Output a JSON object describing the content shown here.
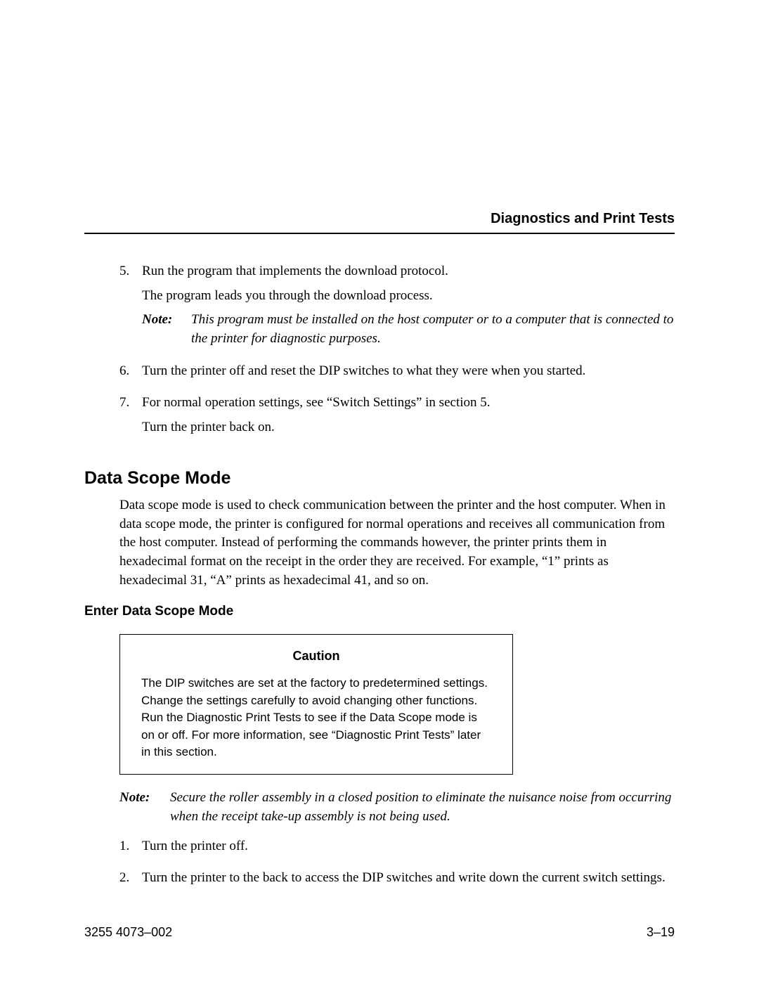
{
  "header": {
    "running_title": "Diagnostics and Print Tests"
  },
  "list1": {
    "items": [
      {
        "num": "5.",
        "p1": "Run the program that implements the download protocol.",
        "p2": "The program leads you through the download process.",
        "note_label": "Note:",
        "note_text": "This program must be installed on the host computer or to a computer that is connected to the printer for diagnostic purposes."
      },
      {
        "num": "6.",
        "p1": "Turn the printer off and reset the DIP switches to what they were when you started."
      },
      {
        "num": "7.",
        "p1": "For normal operation settings, see “Switch Settings” in section 5.",
        "p2": "Turn the printer back on."
      }
    ]
  },
  "section": {
    "title": "Data Scope Mode",
    "para": "Data scope mode is used to check communication between the printer and the host computer. When in data scope mode, the printer is configured for normal operations and receives all communication from the host computer. Instead of performing the commands however, the printer prints them in hexadecimal format on the receipt in the order they are received. For example, “1” prints as hexadecimal 31, “A” prints as hexadecimal 41, and so on."
  },
  "subsection": {
    "title": "Enter Data Scope Mode"
  },
  "caution": {
    "title": "Caution",
    "body": "The DIP switches are set at the factory to predetermined settings. Change the settings carefully to avoid changing other functions. Run the Diagnostic Print Tests to see if the Data Scope mode is on or off. For more information, see “Diagnostic Print Tests” later in this section."
  },
  "note2": {
    "label": "Note:",
    "text": "Secure the roller assembly in a closed position to eliminate the nuisance noise from occurring when the receipt take-up assembly is not being used."
  },
  "list2": {
    "items": [
      {
        "num": "1.",
        "p1": "Turn the printer off."
      },
      {
        "num": "2.",
        "p1": "Turn the printer to the back to access the DIP switches and write down the current switch settings."
      }
    ]
  },
  "footer": {
    "left": "3255 4073–002",
    "right": "3–19"
  }
}
